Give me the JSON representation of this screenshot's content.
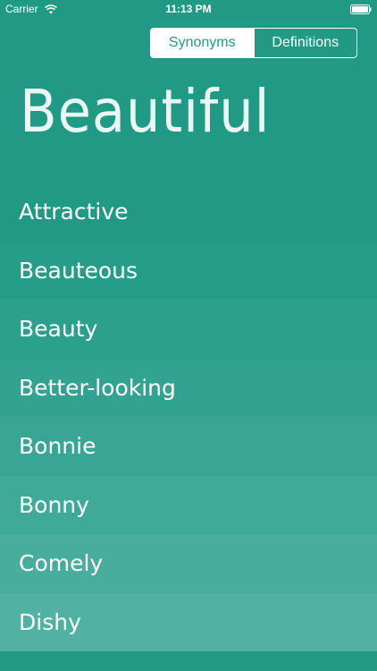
{
  "status_bar": {
    "carrier": "Carrier",
    "time": "11:13 PM"
  },
  "segmented_control": {
    "selected": "Synonyms",
    "options": [
      "Synonyms",
      "Definitions"
    ]
  },
  "headword": "Beautiful",
  "synonyms": [
    {
      "label": "Attractive",
      "color": "#209a85"
    },
    {
      "label": "Beauteous",
      "color": "#259d89"
    },
    {
      "label": "Beauty",
      "color": "#2ba08c"
    },
    {
      "label": "Better-looking",
      "color": "#32a391"
    },
    {
      "label": "Bonnie",
      "color": "#39a695"
    },
    {
      "label": "Bonny",
      "color": "#40aa99"
    },
    {
      "label": "Comely",
      "color": "#48ad9d"
    },
    {
      "label": "Dishy",
      "color": "#51b1a2"
    }
  ],
  "colors": {
    "background": "#219a85",
    "text": "#ffffff"
  },
  "icons": {
    "wifi": "wifi-icon",
    "battery": "battery-icon"
  }
}
